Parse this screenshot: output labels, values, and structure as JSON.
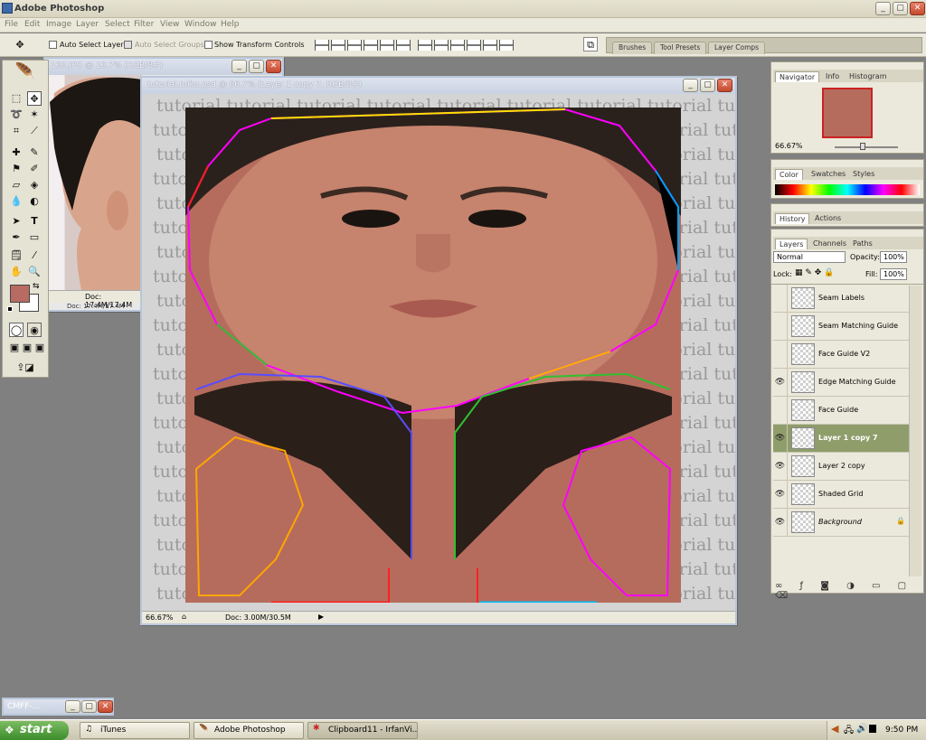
{
  "app": {
    "title": "Adobe Photoshop"
  },
  "menu": [
    "File",
    "Edit",
    "Image",
    "Layer",
    "Select",
    "Filter",
    "View",
    "Window",
    "Help"
  ],
  "options": {
    "auto_select_layer": "Auto Select Layer",
    "auto_select_groups": "Auto Select Groups",
    "show_transform": "Show Transform Controls",
    "well_tabs": [
      "Brushes",
      "Tool Presets",
      "Layer Comps"
    ]
  },
  "doc_back": {
    "title": "160.JPG @ 16.7% (RGB/8#)",
    "status": "Doc: 17.4M/17.4M",
    "status2": "Doc: 17.4M/17.4M"
  },
  "doc_main": {
    "title": "tutorial.miko.psd @ 66.7% (Layer 1 copy 7, RGB/8#)",
    "zoom": "66.67%",
    "status": "Doc: 3.00M/30.5M",
    "watermark": "tutorial"
  },
  "navigator": {
    "tabs": [
      "Navigator",
      "Info",
      "Histogram"
    ],
    "zoom": "66.67%"
  },
  "color_panel": {
    "tabs": [
      "Color",
      "Swatches",
      "Styles"
    ]
  },
  "history_panel": {
    "tabs": [
      "History",
      "Actions"
    ]
  },
  "layers_panel": {
    "tabs": [
      "Layers",
      "Channels",
      "Paths"
    ],
    "blend_mode": "Normal",
    "opacity_label": "Opacity:",
    "opacity": "100%",
    "lock_label": "Lock:",
    "fill_label": "Fill:",
    "fill": "100%",
    "layers": [
      {
        "name": "Seam Labels",
        "visible": false,
        "selected": false
      },
      {
        "name": "Seam Matching Guide",
        "visible": false,
        "selected": false
      },
      {
        "name": "Face Guide V2",
        "visible": false,
        "selected": false
      },
      {
        "name": "Edge Matching Guide",
        "visible": true,
        "selected": false
      },
      {
        "name": "Face Guide",
        "visible": false,
        "selected": false
      },
      {
        "name": "Layer 1 copy 7",
        "visible": true,
        "selected": true
      },
      {
        "name": "Layer 2 copy",
        "visible": true,
        "selected": false
      },
      {
        "name": "Shaded Grid",
        "visible": true,
        "selected": false
      },
      {
        "name": "Background",
        "visible": true,
        "selected": false
      }
    ]
  },
  "minimized": {
    "title": "CMFF-..."
  },
  "taskbar": {
    "start": "start",
    "buttons": [
      "iTunes",
      "Adobe Photoshop",
      "Clipboard11 - IrfanVi..."
    ],
    "clock": "9:50 PM"
  },
  "colors": {
    "foreground": "#b76b62",
    "background": "#ffffff",
    "selected_layer": "#8f9d6b"
  }
}
